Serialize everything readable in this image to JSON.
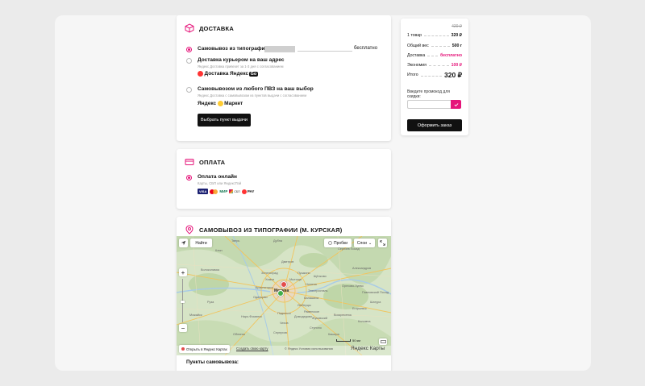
{
  "delivery": {
    "title": "ДОСТАВКА",
    "options": [
      {
        "title": "Самовывоз из типографии",
        "price": "бесплатно",
        "selected": true
      },
      {
        "title": "Доставка курьером на ваш адрес",
        "sub": "Яндекс Доставка привезет за 1-3 дня с согласованием",
        "brand1": "Доставка",
        "brand2": "Яндекс",
        "brand2_badge": "Go",
        "selected": false
      },
      {
        "title": "Самовывозом из любого ПВЗ на ваш выбор",
        "sub": "Яндекс Доставка с самовывозом из пунктов выдачи с согласованием",
        "brand": "Яндекс",
        "brand_suffix": "Маркет",
        "selected": false
      }
    ],
    "pickup_button": "Выбрать пункт выдачи"
  },
  "payment": {
    "title": "ОПЛАТА",
    "option_title": "Оплата онлайн",
    "option_sub": "Карты, СБП или ЯндексПэй",
    "logos": [
      "VISA",
      "MC",
      "МИР",
      "СБП",
      "PAY"
    ]
  },
  "pickup": {
    "title": "САМОВЫВОЗ ИЗ ТИПОГРАФИИ (М. КУРСКАЯ)",
    "find_button": "Найти",
    "traffic_button": "Пробки",
    "layers_button": "Слои",
    "open_in_yandex": "Открыть в Яндекс Картах",
    "create_map": "Создать свою карту",
    "copyright": "© Яндекс Условия использования",
    "scale": "50 км",
    "brand": "Яндекс Карты",
    "city_label": "Москва",
    "points_title": "Пункты самовывоза:",
    "places": [
      "Тверь",
      "Дубна",
      "Клин",
      "Сергиев Посад",
      "Зеленоград",
      "Химки",
      "Подольск",
      "Коломна",
      "Серпухов",
      "Орехово-Зуево",
      "Ногинск",
      "Электросталь",
      "Раменское",
      "Наро-Фоминск",
      "Руза",
      "Можайск",
      "Волоколамск",
      "Дмитров",
      "Александров",
      "Чехов",
      "Обнинск",
      "Кашира",
      "Ступино",
      "Балашиха",
      "Люберцы",
      "Одинцово",
      "Красногорск",
      "Пушкино",
      "Щёлково",
      "Мытищи",
      "Жуковский",
      "Домодедово",
      "Егорьевск",
      "Шатура",
      "Воскресенск",
      "Павловский Посад"
    ],
    "colors": {
      "water": "#a8cbe6",
      "forest": "#b9d4a4",
      "road": "#f2c45c",
      "city": "#e8d9c2"
    }
  },
  "summary": {
    "old_price": "420 ₽",
    "rows": [
      {
        "label": "1 товар",
        "value": "320 ₽",
        "color": "#111"
      },
      {
        "label": "Общий вес",
        "value": "500 г",
        "color": "#111"
      },
      {
        "label": "Доставка",
        "value": "бесплатно",
        "color": "#e5157a"
      },
      {
        "label": "Экономия",
        "value": "100 ₽",
        "color": "#e5157a"
      }
    ],
    "total_label": "Итого",
    "total_value": "320 ₽",
    "promo_label": "Введите промокод для скидки:",
    "promo_value": "",
    "checkout_button": "Оформить заказ"
  },
  "colors": {
    "accent": "#e5157a",
    "dark": "#111111"
  }
}
